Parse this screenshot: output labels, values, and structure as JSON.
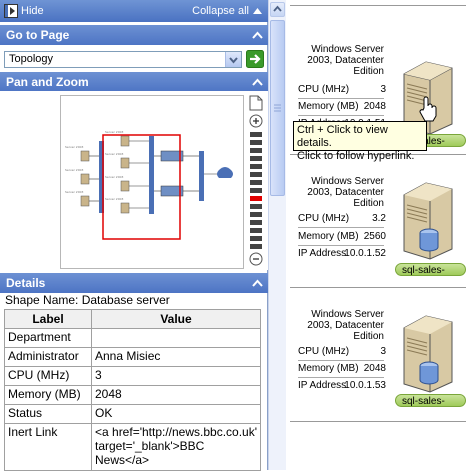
{
  "topbar": {
    "hide_label": "Hide",
    "collapse_label": "Collapse all"
  },
  "goto": {
    "header": "Go to Page",
    "selected": "Topology"
  },
  "panzoom": {
    "header": "Pan and Zoom"
  },
  "details": {
    "header": "Details",
    "shape_name": "Shape Name: Database server",
    "columns": [
      "Label",
      "Value"
    ],
    "rows": [
      {
        "label": "Department",
        "value": ""
      },
      {
        "label": "Administrator",
        "value": "Anna Misiec"
      },
      {
        "label": "CPU (MHz)",
        "value": "3"
      },
      {
        "label": "Memory (MB)",
        "value": "2048"
      },
      {
        "label": "Status",
        "value": "OK"
      },
      {
        "label": "Inert Link",
        "value": "<a href='http://news.bbc.co.uk' target='_blank'>BBC News</a>"
      }
    ]
  },
  "servers": [
    {
      "title_l1": "Windows Server",
      "title_l2": "2003, Datacenter",
      "title_l3": "Edition",
      "cpu_label": "CPU (MHz)",
      "cpu": "3",
      "mem_label": "Memory (MB)",
      "mem": "2048",
      "ip_label": "IP Address",
      "ip": "10.0.1.51",
      "name": "sql-sales-"
    },
    {
      "title_l1": "Windows Server",
      "title_l2": "2003, Datacenter",
      "title_l3": "Edition",
      "cpu_label": "CPU (MHz)",
      "cpu": "3.2",
      "mem_label": "Memory (MB)",
      "mem": "2560",
      "ip_label": "IP Address",
      "ip": "10.0.1.52",
      "name": "sql-sales-"
    },
    {
      "title_l1": "Windows Server",
      "title_l2": "2003, Datacenter",
      "title_l3": "Edition",
      "cpu_label": "CPU (MHz)",
      "cpu": "3",
      "mem_label": "Memory (MB)",
      "mem": "2048",
      "ip_label": "IP Address",
      "ip": "10.0.1.53",
      "name": "sql-sales-"
    }
  ],
  "tooltip": {
    "line1": "Ctrl + Click to view details.",
    "line2": "Click to follow hyperlink."
  },
  "colors": {
    "header": "#4d74c4",
    "pill": "#9fca5a",
    "highlight": "#e00000"
  }
}
